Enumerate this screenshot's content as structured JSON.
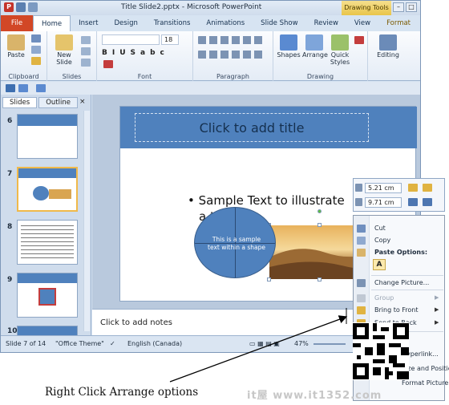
{
  "window": {
    "title": "Title Slide2.pptx - Microsoft PowerPoint",
    "contextual_tab": "Drawing Tools"
  },
  "tabs": [
    "File",
    "Home",
    "Insert",
    "Design",
    "Transitions",
    "Animations",
    "Slide Show",
    "Review",
    "View",
    "Format"
  ],
  "ribbon": {
    "groups": [
      "Clipboard",
      "Slides",
      "Font",
      "Paragraph",
      "Drawing"
    ],
    "paste": "Paste",
    "new_slide": "New Slide",
    "font_size": "18",
    "shapes": "Shapes",
    "arrange": "Arrange",
    "quick_styles": "Quick Styles",
    "editing": "Editing"
  },
  "left_pane": {
    "tabs": [
      "Slides",
      "Outline"
    ],
    "close": "×",
    "slide_numbers": [
      "6",
      "7",
      "8",
      "9",
      "10"
    ]
  },
  "slide": {
    "title_placeholder": "Click to add title",
    "bullet_line1": "• Sample Text to illustrate",
    "bullet_line2": "a      t",
    "ellipse_text": "This is a sample text within a shape"
  },
  "notes": {
    "placeholder": "Click to add notes"
  },
  "status": {
    "slide_info": "Slide 7 of 14",
    "theme": "\"Office Theme\"",
    "language": "English (Canada)",
    "zoom": "47%"
  },
  "size_toolbar": {
    "height": "5.21 cm",
    "width": "9.71 cm"
  },
  "context_menu": {
    "cut": "Cut",
    "copy": "Copy",
    "paste_options": "Paste Options:",
    "paste_glyph": "A",
    "change_picture": "Change Picture...",
    "group": "Group",
    "bring_to_front": "Bring to Front",
    "send_to_back": "Send to Back",
    "hyperlink": "Hyperlink...",
    "size_position": "Size and Position...",
    "format_picture": "Format Picture..."
  },
  "caption": "Right Click Arrange options",
  "watermark": "it屋 www.it1352.com",
  "colors": {
    "slide_accent": "#4f81bd",
    "file_tab": "#d24726",
    "drawing_tools": "#e9c54a"
  }
}
